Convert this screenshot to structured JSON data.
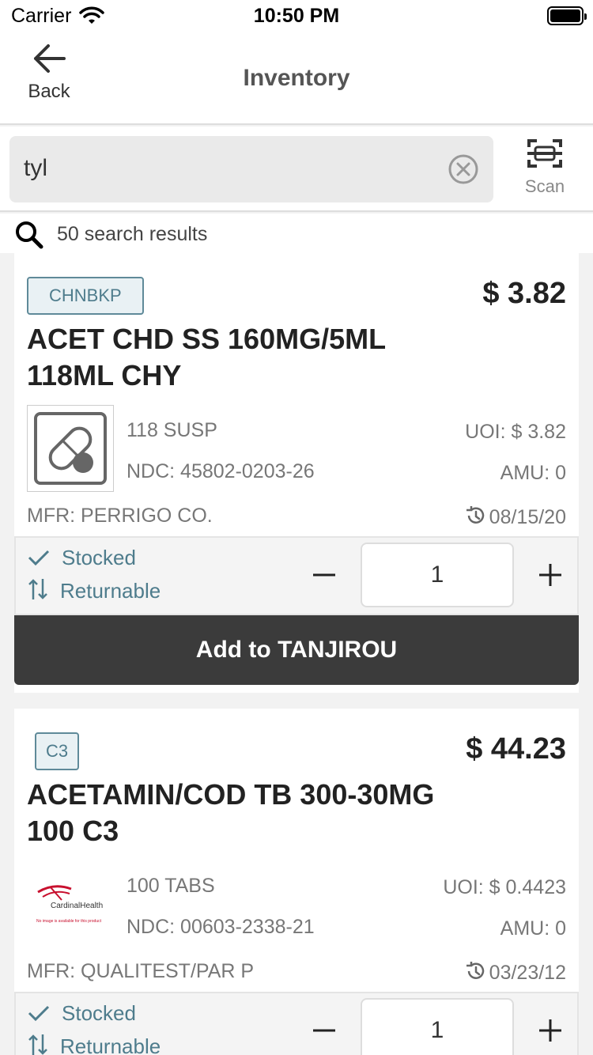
{
  "status_bar": {
    "carrier": "Carrier",
    "time": "10:50 PM"
  },
  "nav": {
    "back_label": "Back",
    "title": "Inventory"
  },
  "search": {
    "query": "tyl",
    "scan_label": "Scan"
  },
  "results": {
    "summary": "50 search results"
  },
  "items": [
    {
      "badge": "CHNBKP",
      "price": "$ 3.82",
      "name_line1": "ACET CHD SS 160MG/5ML",
      "name_line2": "118ML CHY",
      "package": "118 SUSP",
      "ndc": "NDC: 45802-0203-26",
      "uoi": "UOI: $ 3.82",
      "amu": "AMU: 0",
      "mfr": "MFR: PERRIGO CO.",
      "date": "08/15/20",
      "stocked_label": "Stocked",
      "returnable_label": "Returnable",
      "quantity": "1",
      "add_label": "Add to TANJIROU",
      "image": "pill-placeholder-icon"
    },
    {
      "badge": "C3",
      "price": "$ 44.23",
      "name_line1": "ACETAMIN/COD TB 300-30MG",
      "name_line2": "100 C3",
      "package": "100 TABS",
      "ndc": "NDC: 00603-2338-21",
      "uoi": "UOI: $ 0.4423",
      "amu": "AMU: 0",
      "mfr": "MFR: QUALITEST/PAR P",
      "date": "03/23/12",
      "stocked_label": "Stocked",
      "returnable_label": "Returnable",
      "quantity": "1",
      "image": "cardinal-health-logo",
      "logo_text": "CardinalHealth",
      "logo_note": "No image is available for this product"
    }
  ],
  "colors": {
    "accent": "#4e7c8c",
    "button": "#3b3b3b"
  }
}
